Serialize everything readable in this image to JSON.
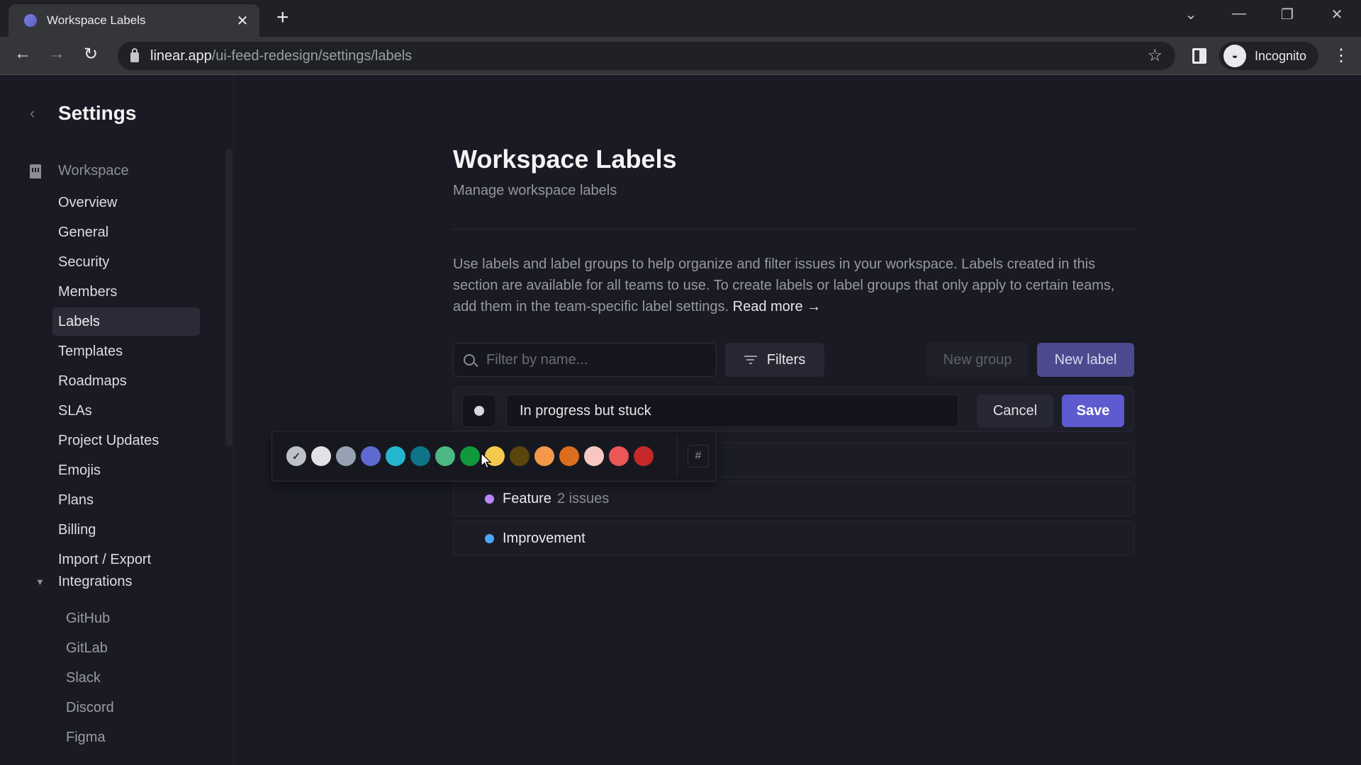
{
  "browser": {
    "tab_title": "Workspace Labels",
    "url_host": "linear.app",
    "url_path": "/ui-feed-redesign/settings/labels",
    "profile_label": "Incognito",
    "icons": {
      "back": "←",
      "forward": "→",
      "reload": "↻",
      "star": "☆",
      "close_tab": "✕",
      "new_tab": "+",
      "tab_search": "⌄",
      "minimize": "—",
      "restore": "❐",
      "close_window": "✕",
      "menu": "⋮",
      "incognito": "🕶"
    }
  },
  "sidebar": {
    "back_icon": "‹",
    "title": "Settings",
    "group_label": "Workspace",
    "items": [
      {
        "label": "Overview"
      },
      {
        "label": "General"
      },
      {
        "label": "Security"
      },
      {
        "label": "Members"
      },
      {
        "label": "Labels",
        "active": true
      },
      {
        "label": "Templates"
      },
      {
        "label": "Roadmaps"
      },
      {
        "label": "SLAs"
      },
      {
        "label": "Project Updates"
      },
      {
        "label": "Emojis"
      },
      {
        "label": "Plans"
      },
      {
        "label": "Billing"
      },
      {
        "label": "Import / Export"
      }
    ],
    "integrations": {
      "label": "Integrations",
      "caret": "▼",
      "items": [
        {
          "label": "GitHub"
        },
        {
          "label": "GitLab"
        },
        {
          "label": "Slack"
        },
        {
          "label": "Discord"
        },
        {
          "label": "Figma"
        }
      ]
    }
  },
  "main": {
    "title": "Workspace Labels",
    "subtitle": "Manage workspace labels",
    "description": "Use labels and label groups to help organize and filter issues in your workspace. Labels created in this section are available for all teams to use. To create labels or label groups that only apply to certain teams, add them in the team-specific label settings. ",
    "read_more": "Read more →",
    "search_placeholder": "Filter by name...",
    "filters_label": "Filters",
    "new_group_label": "New group",
    "new_label_label": "New label",
    "edit": {
      "name_value": "In progress but stuck",
      "cancel_label": "Cancel",
      "save_label": "Save",
      "selected_color": "#d8d8dc"
    },
    "labels": [
      {
        "name": "Feature",
        "count": "2 issues",
        "color": "#bb87fc"
      },
      {
        "name": "Improvement",
        "count": "",
        "color": "#4ea7fc"
      }
    ]
  },
  "color_picker": {
    "check_icon": "✓",
    "hex_label": "#",
    "swatches": [
      {
        "color": "#bec2c8",
        "selected": true
      },
      {
        "color": "#e2e2e6"
      },
      {
        "color": "#95a2b3"
      },
      {
        "color": "#5e6ad2"
      },
      {
        "color": "#26b5ce"
      },
      {
        "color": "#0f7488"
      },
      {
        "color": "#4cb782"
      },
      {
        "color": "#0f983e"
      },
      {
        "color": "#f2c94c"
      },
      {
        "color": "#5a450d"
      },
      {
        "color": "#f2994a"
      },
      {
        "color": "#db6e1f"
      },
      {
        "color": "#f7c8c1"
      },
      {
        "color": "#eb5757"
      },
      {
        "color": "#c52828"
      }
    ]
  }
}
